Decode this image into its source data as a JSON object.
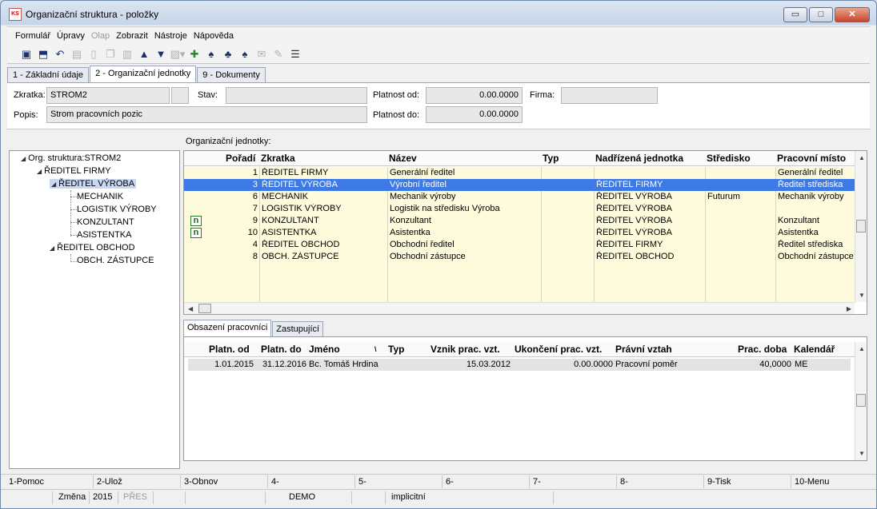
{
  "window": {
    "title": "Organizační struktura - položky",
    "icon_text": "KS",
    "minimize": "▭",
    "maximize": "□",
    "close": "✕"
  },
  "menu": [
    "Formulář",
    "Úpravy",
    "Olap",
    "Zobrazit",
    "Nástroje",
    "Nápověda"
  ],
  "menu_disabled": [
    "Olap"
  ],
  "toolbar": {
    "icons": [
      "save-icon",
      "save-close-icon",
      "undo-icon",
      "open-icon",
      "new-icon",
      "copy-icon",
      "book-icon",
      "arrow-up-icon",
      "arrow-down-icon",
      "export-icon",
      "import-icon",
      "binoculars-icon",
      "binoculars-next-icon",
      "binoculars-filter-icon",
      "mail-icon",
      "edit-icon",
      "list-icon"
    ]
  },
  "tabs": [
    "1 - Základní údaje",
    "2 - Organizační jednotky",
    "9 - Dokumenty"
  ],
  "active_tab": 1,
  "form": {
    "zkratka_label": "Zkratka:",
    "zkratka_value": "STROM2",
    "stav_label": "Stav:",
    "stav_value": "",
    "platnost_od_label": "Platnost od:",
    "platnost_od_value": "0.00.0000",
    "firma_label": "Firma:",
    "firma_value": "",
    "popis_label": "Popis:",
    "popis_value": "Strom pracovních pozic",
    "platnost_do_label": "Platnost do:",
    "platnost_do_value": "0.00.0000"
  },
  "tree": {
    "root": "Org. struktura:STROM2",
    "nodes": [
      {
        "label": "ŘEDITEL FIRMY"
      },
      {
        "label": "ŘEDITEL VÝROBA"
      },
      {
        "label": "MECHANIK"
      },
      {
        "label": "LOGISTIK VÝROBY"
      },
      {
        "label": "KONZULTANT"
      },
      {
        "label": "ASISTENTKA"
      },
      {
        "label": "ŘEDITEL OBCHOD"
      },
      {
        "label": "OBCH. ZÁSTUPCE"
      }
    ]
  },
  "units": {
    "section_label": "Organizační jednotky:",
    "columns": [
      "Pořadí",
      "Zkratka",
      "Název",
      "Typ",
      "Nadřízená jednotka",
      "Středisko",
      "Pracovní místo"
    ],
    "rows": [
      {
        "poradi": "1",
        "zkratka": "ŘEDITEL FIRMY",
        "nazev": "Generální ředitel",
        "typ": "",
        "nadrizena": "",
        "stredisko": "",
        "misto": "Generální ředitel",
        "icon": ""
      },
      {
        "poradi": "3",
        "zkratka": "ŘEDITEL VÝROBA",
        "nazev": "Výrobní ředitel",
        "typ": "",
        "nadrizena": "ŘEDITEL FIRMY",
        "stredisko": "",
        "misto": "Ředitel střediska",
        "icon": ""
      },
      {
        "poradi": "6",
        "zkratka": "MECHANIK",
        "nazev": "Mechanik výroby",
        "typ": "",
        "nadrizena": "ŘEDITEL VÝROBA",
        "stredisko": "Futurum",
        "misto": "Mechanik výroby",
        "icon": ""
      },
      {
        "poradi": "7",
        "zkratka": "LOGISTIK VÝROBY",
        "nazev": "Logistik na středisku Výroba",
        "typ": "",
        "nadrizena": "ŘEDITEL VÝROBA",
        "stredisko": "",
        "misto": "",
        "icon": ""
      },
      {
        "poradi": "9",
        "zkratka": "KONZULTANT",
        "nazev": "Konzultant",
        "typ": "",
        "nadrizena": "ŘEDITEL VÝROBA",
        "stredisko": "",
        "misto": "Konzultant",
        "icon": "n"
      },
      {
        "poradi": "10",
        "zkratka": "ASISTENTKA",
        "nazev": "Asistentka",
        "typ": "",
        "nadrizena": "ŘEDITEL VÝROBA",
        "stredisko": "",
        "misto": "Asistentka",
        "icon": "n"
      },
      {
        "poradi": "4",
        "zkratka": "ŘEDITEL OBCHOD",
        "nazev": "Obchodní ředitel",
        "typ": "",
        "nadrizena": "ŘEDITEL FIRMY",
        "stredisko": "",
        "misto": "Ředitel střediska",
        "icon": ""
      },
      {
        "poradi": "8",
        "zkratka": "OBCH. ZÁSTUPCE",
        "nazev": "Obchodní zástupce",
        "typ": "",
        "nadrizena": "ŘEDITEL OBCHOD",
        "stredisko": "",
        "misto": "Obchodní zástupce",
        "icon": ""
      }
    ],
    "selected_row": 1
  },
  "subtabs": [
    "Obsazení pracovníci",
    "Zastupující"
  ],
  "active_subtab": 0,
  "occupants": {
    "columns": [
      "Platn. od",
      "Platn. do",
      "Jméno",
      "Typ",
      "Vznik prac. vzt.",
      "Ukončení prac. vzt.",
      "Právní vztah",
      "Prac. doba",
      "Kalendář"
    ],
    "rows": [
      {
        "od": "1.01.2015",
        "do": "31.12.2016",
        "jmeno": "Bc. Tomáš Hrdina",
        "typ": "",
        "vznik": "15.03.2012",
        "ukonceni": "0.00.0000",
        "vztah": "Pracovní poměr",
        "doba": "40,0000",
        "kalendar": "ME"
      }
    ]
  },
  "fkeys": [
    "1-Pomoc",
    "2-Ulož",
    "3-Obnov",
    "4-",
    "5-",
    "6-",
    "7-",
    "8-",
    "9-Tisk",
    "10-Menu"
  ],
  "status": {
    "mode": "Změna",
    "year": "2015",
    "overwrite": "PŘES",
    "db": "DEMO",
    "profile": "implicitní"
  }
}
